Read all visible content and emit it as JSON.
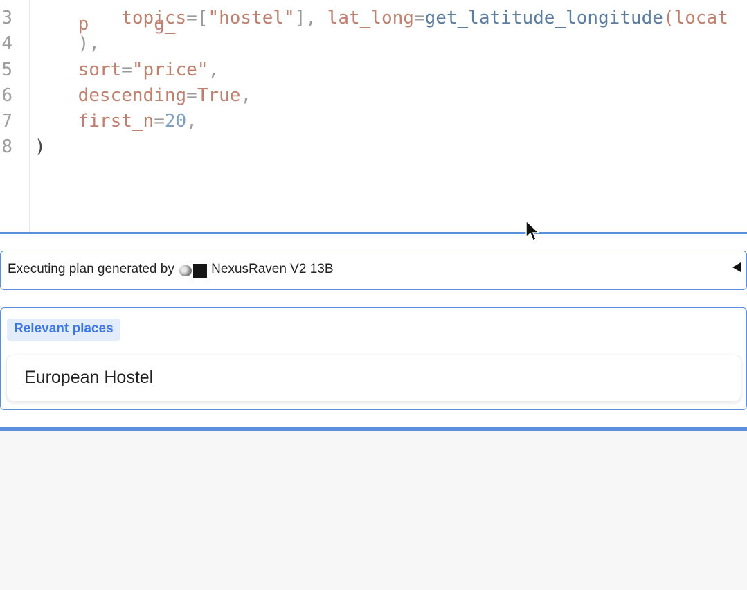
{
  "editor": {
    "lines": [
      {
        "num": "3",
        "tokens": [
          {
            "t": "        ",
            "c": "c-plain"
          },
          {
            "t": "topics",
            "c": "c-param"
          },
          {
            "t": "=[",
            "c": "c-punct"
          },
          {
            "t": "\"hostel\"",
            "c": "c-str"
          },
          {
            "t": "], ",
            "c": "c-punct"
          },
          {
            "t": "lat_long",
            "c": "c-param"
          },
          {
            "t": "=",
            "c": "c-punct"
          },
          {
            "t": "get_latitude_longitude",
            "c": "c-fn"
          },
          {
            "t": "(locat",
            "c": "c-param"
          }
        ]
      },
      {
        "num": "4",
        "tokens": [
          {
            "t": "    ",
            "c": "c-plain"
          },
          {
            "t": "),",
            "c": "c-punct"
          }
        ]
      },
      {
        "num": "5",
        "tokens": [
          {
            "t": "    ",
            "c": "c-plain"
          },
          {
            "t": "sort",
            "c": "c-param"
          },
          {
            "t": "=",
            "c": "c-punct"
          },
          {
            "t": "\"price\"",
            "c": "c-str"
          },
          {
            "t": ",",
            "c": "c-punct"
          }
        ]
      },
      {
        "num": "6",
        "tokens": [
          {
            "t": "    ",
            "c": "c-plain"
          },
          {
            "t": "descending",
            "c": "c-param"
          },
          {
            "t": "=",
            "c": "c-punct"
          },
          {
            "t": "True",
            "c": "c-param"
          },
          {
            "t": ",",
            "c": "c-punct"
          }
        ]
      },
      {
        "num": "7",
        "tokens": [
          {
            "t": "    ",
            "c": "c-plain"
          },
          {
            "t": "first_n",
            "c": "c-param"
          },
          {
            "t": "=",
            "c": "c-punct"
          },
          {
            "t": "20",
            "c": "c-num"
          },
          {
            "t": ",",
            "c": "c-punct"
          }
        ]
      },
      {
        "num": "8",
        "tokens": [
          {
            "t": ")",
            "c": "c-plain"
          }
        ]
      }
    ]
  },
  "accordion": {
    "prefix": "Executing plan generated by",
    "model": "NexusRaven V2 13B",
    "icons": [
      "bird-icon",
      "black-square-icon"
    ],
    "toggle_icon": "triangle-left-icon"
  },
  "places": {
    "label": "Relevant places",
    "items": [
      "European Hostel"
    ]
  },
  "colors": {
    "accent": "#5b8fdc",
    "label_text": "#3b78e7",
    "label_bg": "#e3ecfb"
  }
}
